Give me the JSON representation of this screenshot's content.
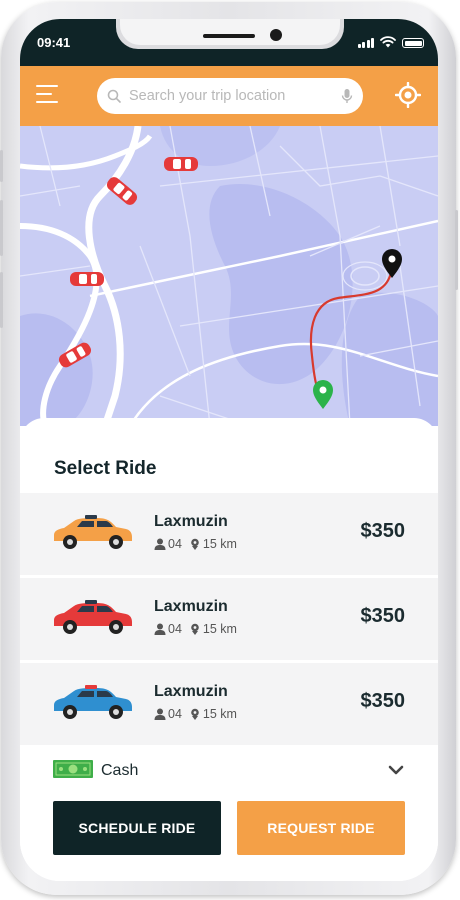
{
  "status_bar": {
    "time": "09:41",
    "icons": [
      "signal-icon",
      "wifi-icon",
      "battery-icon"
    ]
  },
  "header": {
    "menu_icon": "menu-icon",
    "search_placeholder": "Search your trip location",
    "search_value": "",
    "search_icon": "search-icon",
    "mic_icon": "mic-icon",
    "locate_icon": "locate-icon"
  },
  "map": {
    "markers": [
      "car-icon",
      "car-icon",
      "car-icon",
      "car-icon",
      "destination-pin-icon",
      "origin-pin-icon"
    ]
  },
  "sheet": {
    "title": "Select Ride",
    "rides": [
      {
        "name": "Laxmuzin",
        "seats": "04",
        "distance": "15 km",
        "price": "$350",
        "car_color": "#f4a047"
      },
      {
        "name": "Laxmuzin",
        "seats": "04",
        "distance": "15 km",
        "price": "$350",
        "car_color": "#e53a3a"
      },
      {
        "name": "Laxmuzin",
        "seats": "04",
        "distance": "15 km",
        "price": "$350",
        "car_color": "#2f8fd0"
      }
    ],
    "payment": {
      "method": "Cash",
      "icon": "cash-icon"
    },
    "schedule_label": "SCHEDULE RIDE",
    "request_label": "REQUEST RIDE"
  },
  "colors": {
    "accent": "#f4a047",
    "dark": "#0f2427",
    "map_background": "#c9cdf4",
    "route": "#d83a2e",
    "origin_pin": "#2bb34a"
  }
}
